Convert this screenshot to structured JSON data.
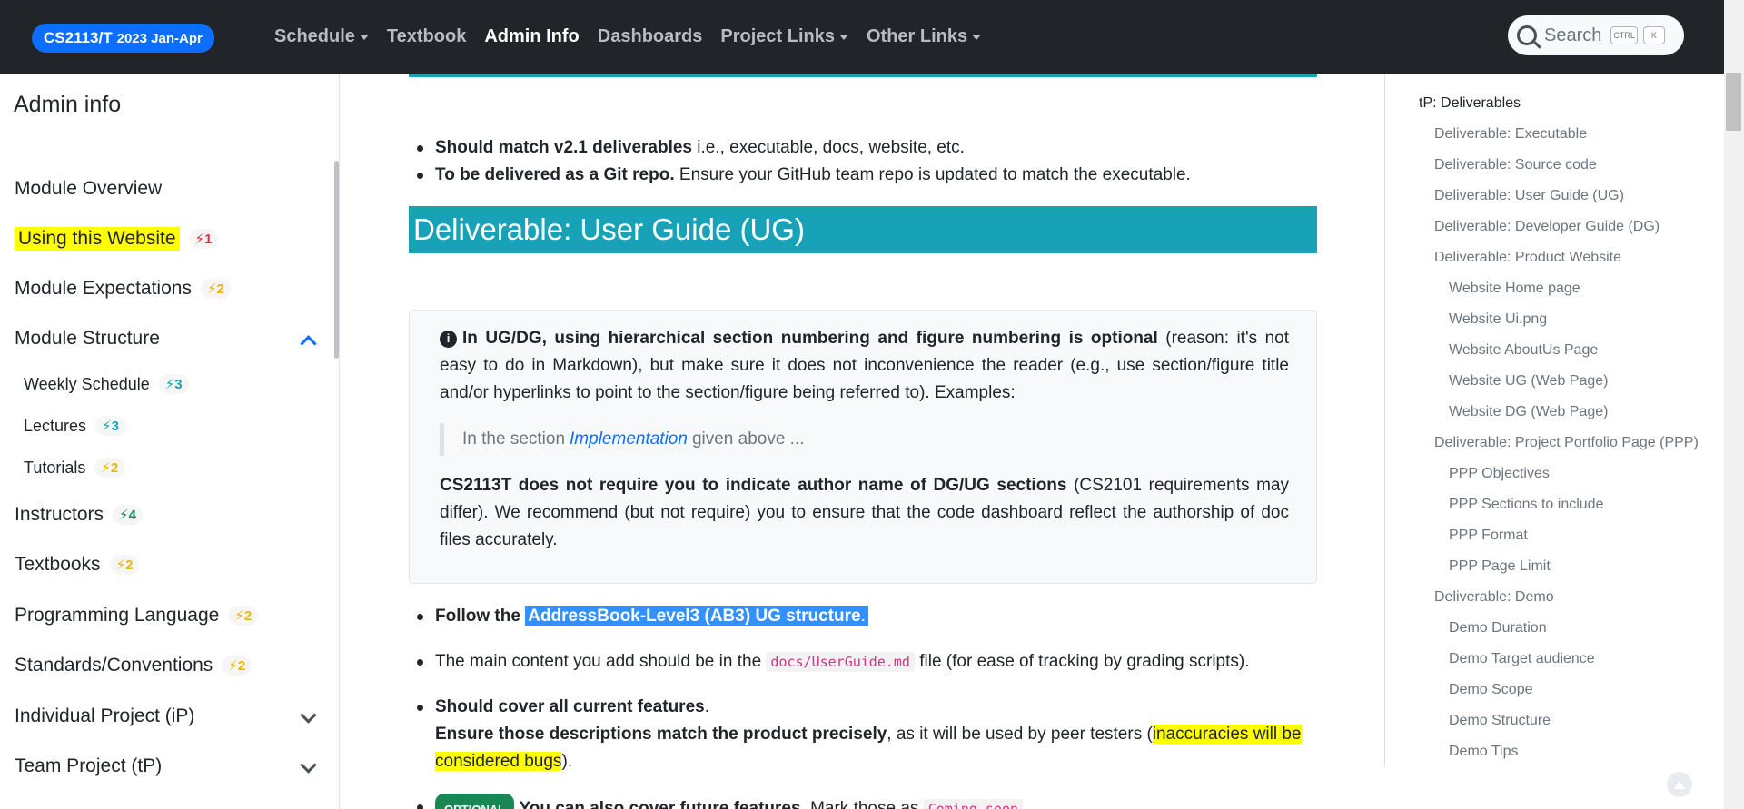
{
  "navbar": {
    "brand_main": "CS2113/T",
    "brand_sub": "2023 Jan-Apr",
    "links": [
      {
        "label": "Schedule",
        "dropdown": true,
        "active": false
      },
      {
        "label": "Textbook",
        "dropdown": false,
        "active": false
      },
      {
        "label": "Admin Info",
        "dropdown": false,
        "active": true
      },
      {
        "label": "Dashboards",
        "dropdown": false,
        "active": false
      },
      {
        "label": "Project Links",
        "dropdown": true,
        "active": false
      },
      {
        "label": "Other Links",
        "dropdown": true,
        "active": false
      }
    ],
    "search_placeholder": "Search",
    "kbd_1": "CTRL",
    "kbd_2": "K"
  },
  "sidebar": {
    "title": "Admin info",
    "items": [
      {
        "label": "Module Overview",
        "badge": ""
      },
      {
        "label": "Using this Website",
        "badge": "⚡1"
      },
      {
        "label": "Module Expectations",
        "badge": "⚡2"
      },
      {
        "label": "Module Structure",
        "badge": ""
      },
      {
        "label": "Weekly Schedule",
        "badge": "⚡3"
      },
      {
        "label": "Lectures",
        "badge": "⚡3"
      },
      {
        "label": "Tutorials",
        "badge": "⚡2"
      },
      {
        "label": "Instructors",
        "badge": "⚡4"
      },
      {
        "label": "Textbooks",
        "badge": "⚡2"
      },
      {
        "label": "Programming Language",
        "badge": "⚡2"
      },
      {
        "label": "Standards/Conventions",
        "badge": "⚡2"
      },
      {
        "label": "Individual Project (iP)",
        "badge": ""
      },
      {
        "label": "Team Project (tP)",
        "badge": ""
      }
    ]
  },
  "main": {
    "bullets_top": [
      {
        "bold": "Should match v2.1 deliverables",
        "rest": " i.e., executable, docs, website, etc."
      },
      {
        "bold": "To be delivered as a Git repo.",
        "rest": " Ensure your GitHub team repo is updated to match the executable."
      }
    ],
    "heading": "Deliverable: User Guide (UG)",
    "info": {
      "icon": "i",
      "bold": "In UG/DG, using hierarchical section numbering and figure numbering is optional",
      "rest": " (reason: it's not easy to do in Markdown), but make sure it does not inconvenience the reader (e.g., use section/figure title and/or hyperlinks to point to the section/figure being referred to). Examples:",
      "quote_pre": "In the section",
      "quote_link": "Implementation",
      "quote_post": "given above ...",
      "p2_bold": "CS2113T does not require you to indicate author name of DG/UG sections",
      "p2_rest": " (CS2101 requirements may differ). We recommend (but not require) you to ensure that the code dashboard reflect the authorship of doc files accurately."
    },
    "b1_pre": "Follow the",
    "b1_sel": "AddressBook-Level3 (AB3) UG structure",
    "b1_dot": ".",
    "b2_pre": "The main content you add should be in the",
    "b2_code": "docs/UserGuide.md",
    "b2_post": "file (for ease of tracking by grading scripts).",
    "b3_bold": "Should cover all current features",
    "b3_dot": ".",
    "b3_bold2": "Ensure those descriptions match the product precisely",
    "b3_mid": ", as it will be used by peer testers (",
    "b3_hl": "inaccuracies will be considered bugs",
    "b3_end": ").",
    "b4_badge": "OPTIONAL",
    "b4_bold": "You can also cover future features",
    "b4_rest": ". Mark those as",
    "b4_code": "Coming soon"
  },
  "toc": {
    "items": [
      {
        "label": "tP: Deliverables",
        "level": 0
      },
      {
        "label": "Deliverable: Executable",
        "level": 1
      },
      {
        "label": "Deliverable: Source code",
        "level": 1
      },
      {
        "label": "Deliverable: User Guide (UG)",
        "level": 1
      },
      {
        "label": "Deliverable: Developer Guide (DG)",
        "level": 1
      },
      {
        "label": "Deliverable: Product Website",
        "level": 1
      },
      {
        "label": "Website Home page",
        "level": 2
      },
      {
        "label": "Website Ui.png",
        "level": 2
      },
      {
        "label": "Website AboutUs Page",
        "level": 2
      },
      {
        "label": "Website UG (Web Page)",
        "level": 2
      },
      {
        "label": "Website DG (Web Page)",
        "level": 2
      },
      {
        "label": "Deliverable: Project Portfolio Page (PPP)",
        "level": 1
      },
      {
        "label": "PPP Objectives",
        "level": 2
      },
      {
        "label": "PPP Sections to include",
        "level": 2
      },
      {
        "label": "PPP Format",
        "level": 2
      },
      {
        "label": "PPP Page Limit",
        "level": 2
      },
      {
        "label": "Deliverable: Demo",
        "level": 1
      },
      {
        "label": "Demo Duration",
        "level": 2
      },
      {
        "label": "Demo Target audience",
        "level": 2
      },
      {
        "label": "Demo Scope",
        "level": 2
      },
      {
        "label": "Demo Structure",
        "level": 2
      },
      {
        "label": "Demo Tips",
        "level": 2
      }
    ]
  },
  "colors": {
    "navbar": "#212529",
    "brand": "#0d6efd",
    "heading": "#17a2b8",
    "highlight": "#ffff00",
    "selection": "#3390ff"
  }
}
